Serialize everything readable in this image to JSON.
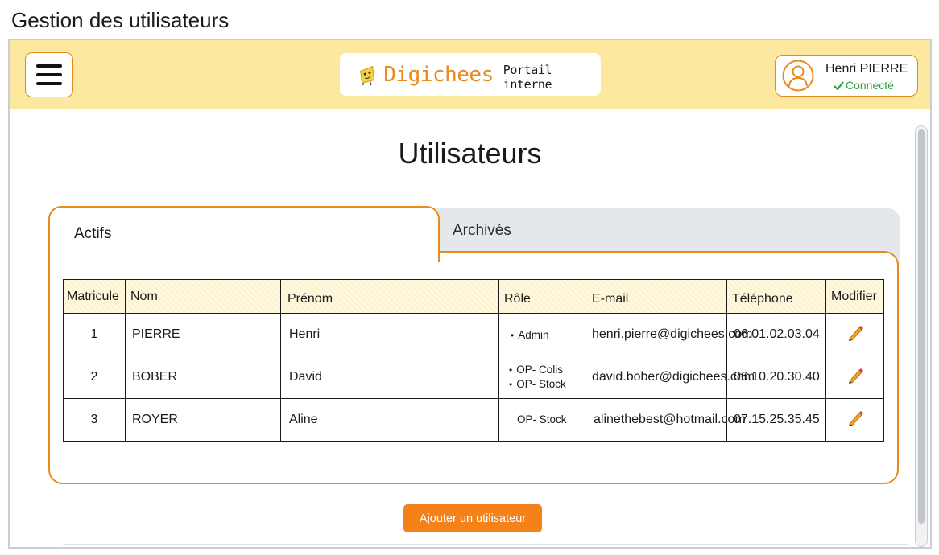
{
  "page_caption": "Gestion des utilisateurs",
  "header": {
    "brand_name": "Digichees",
    "brand_subtitle": "Portail interne",
    "user_name": "Henri PIERRE",
    "user_status": "Connecté",
    "status_color": "#2ea043",
    "accent_color": "#ea8a1c",
    "header_bg": "#fde8a0"
  },
  "main": {
    "title": "Utilisateurs",
    "tabs": [
      {
        "label": "Actifs",
        "active": true
      },
      {
        "label": "Archivés",
        "active": false
      }
    ],
    "table": {
      "columns": [
        "Matricule",
        "Nom",
        "Prénom",
        "Rôle",
        "E-mail",
        "Téléphone",
        "Modifier"
      ],
      "rows": [
        {
          "matricule": "1",
          "nom": "PIERRE",
          "prenom": "Henri",
          "roles": [
            "Admin"
          ],
          "email": "henri.pierre@digichees.com",
          "telephone": "06.01.02.03.04"
        },
        {
          "matricule": "2",
          "nom": "BOBER",
          "prenom": "David",
          "roles": [
            "OP- Colis",
            "OP- Stock"
          ],
          "email": "david.bober@digichees.com",
          "telephone": "06.10.20.30.40"
        },
        {
          "matricule": "3",
          "nom": "ROYER",
          "prenom": "Aline",
          "roles_plain": "OP- Stock",
          "email": "alinethebest@hotmail.com",
          "telephone": "07.15.25.35.45"
        }
      ]
    },
    "add_button_label": "Ajouter un utilisateur",
    "icons": {
      "menu": "hamburger-icon",
      "avatar": "user-avatar-icon",
      "status": "check-icon",
      "edit": "pencil-icon"
    }
  }
}
